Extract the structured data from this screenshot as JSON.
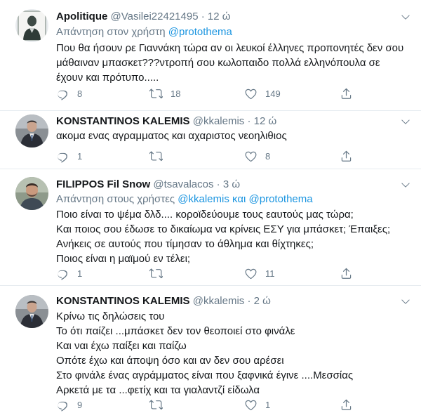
{
  "tweets": [
    {
      "name": "Apolitique",
      "handle": "@Vasilei22421495",
      "time": "12 ώ",
      "reply_prefix": "Απάντηση στον χρήστη",
      "reply_mentions": "@protothema",
      "lines": [
        "Που θα ήσουν ρε Γιαννάκη τώρα αν οι λευκοί έλληνες προπονητές δεν σου",
        "μάθαιναν μπασκετ???ντροπή σου κωλοπαιδο πολλά ελληνόπουλα σε",
        "έχουν και πρότυπο....."
      ],
      "replies": "8",
      "retweets": "18",
      "likes": "149"
    },
    {
      "name": "KONSTANTINOS KALEMIS",
      "handle": "@kkalemis",
      "time": "12 ώ",
      "lines": [
        "ακομα ενας αγραμματος και αχαριστος νεοηλιθιος"
      ],
      "replies": "1",
      "retweets": "",
      "likes": "8"
    },
    {
      "name": "FILIPPOS Fil Snow",
      "handle": "@tsavalacos",
      "time": "3 ώ",
      "reply_prefix": "Απάντηση στους χρήστες",
      "reply_mentions": "@kkalemis και @protothema",
      "lines": [
        "Ποιο είναι το ψέμα δλδ.... κοροϊδεύουμε τους εαυτούς μας τώρα;",
        "Και ποιος σου έδωσε το δικαίωμα να κρίνεις ΕΣΥ για μπάσκετ; Έπαιξες;",
        "Ανήκεις σε αυτούς που τίμησαν το άθλημα και θίχτηκες;",
        "Ποιος είναι η μαϊμού εν τέλει;"
      ],
      "replies": "1",
      "retweets": "",
      "likes": "11"
    },
    {
      "name": "KONSTANTINOS KALEMIS",
      "handle": "@kkalemis",
      "time": "2 ώ",
      "lines": [
        "Κρίνω τις δηλώσεις του",
        "Το ότι παίζει ...μπάσκετ δεν τον θεοποιεί στο φινάλε",
        "Και ναι έχω παίξει και παίζω",
        "Οπότε έχω και άποψη όσο και αν δεν σου αρέσει",
        "Στο φινάλε ένας αγράμματος είναι που ξαφνικά έγινε ....Μεσσίας",
        "Αρκετά με τα ...φετίχ και τα γιαλαντζί είδωλα"
      ],
      "replies": "9",
      "retweets": "",
      "likes": "1"
    }
  ],
  "separator": "·",
  "colors": {
    "text": "#14171a",
    "muted": "#657786",
    "link": "#1b95e0",
    "border": "#e6ecf0"
  },
  "icons": [
    "reply-icon",
    "retweet-icon",
    "like-icon",
    "share-icon",
    "caret-down-icon"
  ]
}
